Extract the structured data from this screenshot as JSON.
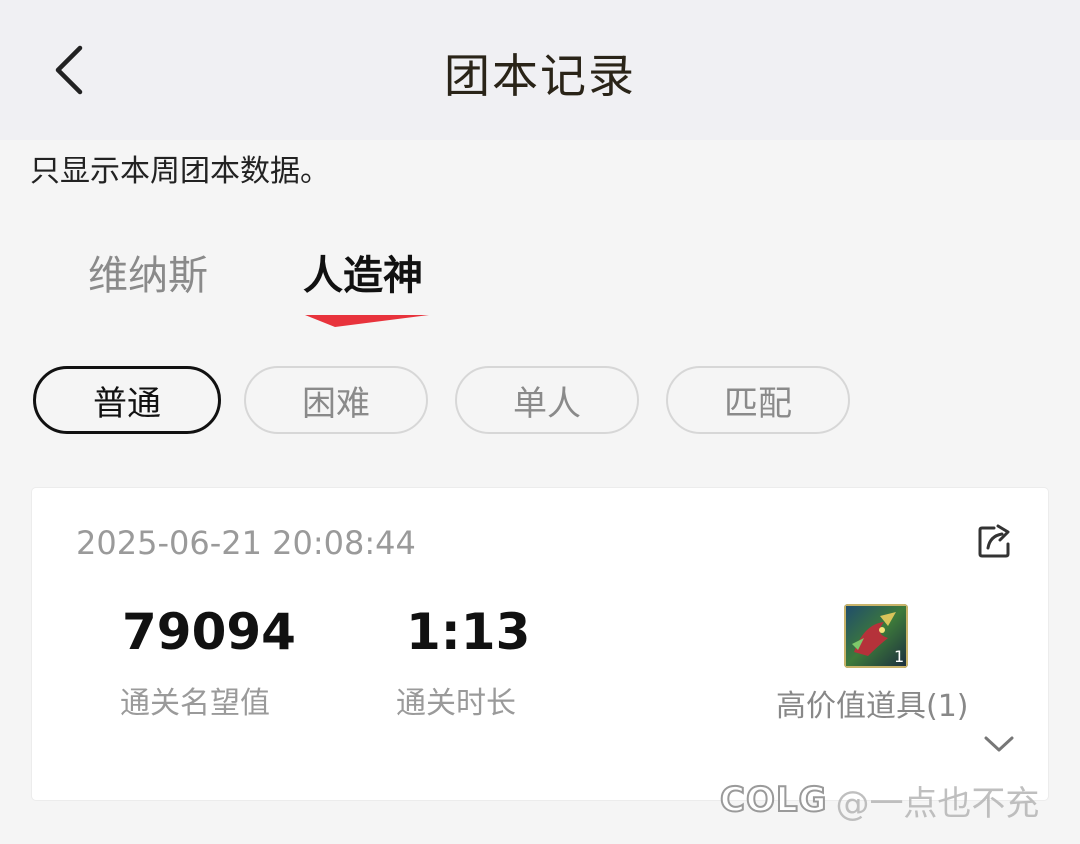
{
  "header": {
    "title": "团本记录",
    "back_icon": "chevron-left-icon"
  },
  "notice": "只显示本周团本数据。",
  "raid_tabs": [
    {
      "label": "维纳斯",
      "active": false
    },
    {
      "label": "人造神",
      "active": true
    }
  ],
  "accent_color": "#e8333c",
  "difficulty_filters": [
    {
      "label": "普通",
      "active": true
    },
    {
      "label": "困难",
      "active": false
    },
    {
      "label": "单人",
      "active": false
    },
    {
      "label": "匹配",
      "active": false
    }
  ],
  "record": {
    "timestamp": "2025-06-21 20:08:44",
    "share_icon": "share-icon",
    "reputation": {
      "value": "79094",
      "label": "通关名望值"
    },
    "duration": {
      "value": "1:13",
      "label": "通关时长"
    },
    "item": {
      "label": "高价值道具(1)",
      "icon": "dragon-item-icon",
      "count_badge": "1"
    },
    "expand_icon": "chevron-down-icon"
  },
  "watermark": {
    "logo": "COLG",
    "text": "@一点也不充"
  }
}
